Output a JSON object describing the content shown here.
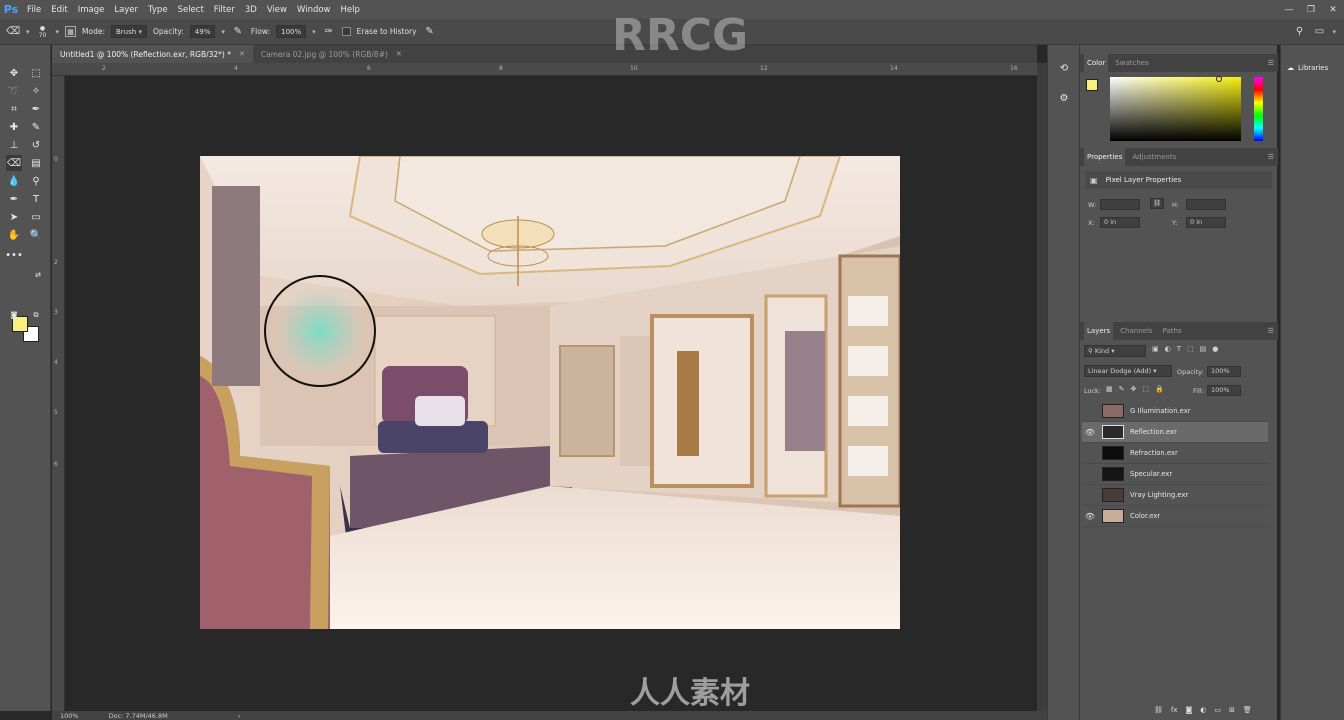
{
  "app": {
    "logo": "Ps"
  },
  "menu": [
    "File",
    "Edit",
    "Image",
    "Layer",
    "Type",
    "Select",
    "Filter",
    "3D",
    "View",
    "Window",
    "Help"
  ],
  "window_controls": [
    "—",
    "❐",
    "✕"
  ],
  "options": {
    "brush_size": "70",
    "mode_label": "Mode:",
    "mode_value": "Brush",
    "opacity_label": "Opacity:",
    "opacity_value": "49%",
    "flow_label": "Flow:",
    "flow_value": "100%",
    "erase_history_label": "Erase to History"
  },
  "tabs": [
    {
      "label": "Untitled1 @ 100% (Reflection.exr, RGB/32*) *",
      "active": true
    },
    {
      "label": "Camera 02.jpg @ 100% (RGB/8#)",
      "active": false
    }
  ],
  "ruler_top": [
    "2",
    "4",
    "6",
    "8",
    "10",
    "12",
    "14",
    "16"
  ],
  "ruler_left": [
    "0",
    "2",
    "3",
    "4",
    "5",
    "6"
  ],
  "status": {
    "zoom": "100%",
    "doc": "Doc: 7.74M/46.8M"
  },
  "color_panel": {
    "tabs": [
      "Color",
      "Swatches"
    ],
    "fg": "#f7f07d",
    "bg": "#ffffff"
  },
  "properties_panel": {
    "tabs": [
      "Properties",
      "Adjustments"
    ],
    "title": "Pixel Layer Properties",
    "w_label": "W:",
    "h_label": "H:",
    "x_label": "X:",
    "y_label": "Y:",
    "x_value": "0 in",
    "y_value": "0 in"
  },
  "layers_panel": {
    "tabs": [
      "Layers",
      "Channels",
      "Paths"
    ],
    "filter": "Kind",
    "blend_mode": "Linear Dodge (Add)",
    "opacity_label": "Opacity:",
    "opacity_value": "100%",
    "lock_label": "Lock:",
    "fill_label": "Fill:",
    "fill_value": "100%",
    "layers": [
      {
        "name": "G Illumination.exr",
        "visible": false,
        "selected": false
      },
      {
        "name": "Reflection.exr",
        "visible": true,
        "selected": true
      },
      {
        "name": "Refraction.exr",
        "visible": false,
        "selected": false
      },
      {
        "name": "Specular.exr",
        "visible": false,
        "selected": false
      },
      {
        "name": "Vray Lighting.exr",
        "visible": false,
        "selected": false
      },
      {
        "name": "Color.exr",
        "visible": true,
        "selected": false
      }
    ]
  },
  "libraries": {
    "label": "Libraries"
  },
  "watermarks": {
    "brand": "RRCG",
    "cn": "人人素材"
  }
}
